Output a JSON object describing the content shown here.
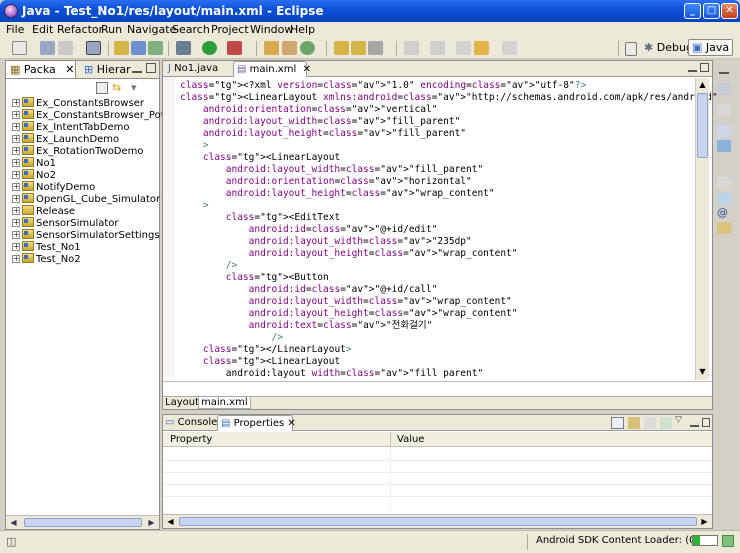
{
  "window": {
    "title": "Java - Test_No1/res/layout/main.xml - Eclipse"
  },
  "menu": [
    "File",
    "Edit",
    "Refactor",
    "Run",
    "Navigate",
    "Search",
    "Project",
    "Window",
    "Help"
  ],
  "perspectives": {
    "debug": "Debug",
    "java": "Java"
  },
  "left_pane": {
    "tabs": [
      "Packa",
      "Hierar"
    ],
    "projects": [
      "Ex_ConstantsBrowser",
      "Ex_ConstantsBrowser_Powe",
      "Ex_IntentTabDemo",
      "Ex_LaunchDemo",
      "Ex_RotationTwoDemo",
      "No1",
      "No2",
      "NotifyDemo",
      "OpenGL_Cube_Simulator",
      "Release",
      "SensorSimulator",
      "SensorSimulatorSettings",
      "Test_No1",
      "Test_No2"
    ]
  },
  "editor": {
    "tabs": [
      "No1.java",
      "main.xml"
    ],
    "bottom_tabs": [
      "Layout",
      "main.xml"
    ],
    "lines": [
      "<?xml version=\"1.0\" encoding=\"utf-8\"?>",
      "<LinearLayout xmlns:android=\"http://schemas.android.com/apk/res/android\"",
      "    android:orientation=\"vertical\"",
      "    android:layout_width=\"fill_parent\"",
      "    android:layout_height=\"fill_parent\"",
      "    >",
      "    <LinearLayout",
      "        android:layout_width=\"fill_parent\"",
      "        android:orientation=\"horizontal\"",
      "        android:layout_height=\"wrap_content\"",
      "    >",
      "        <EditText",
      "            android:id=\"@+id/edit\"",
      "            android:layout_width=\"235dp\"",
      "            android:layout_height=\"wrap_content\"",
      "        />",
      "        <Button",
      "            android:id=\"@+id/call\"",
      "            android:layout_width=\"wrap_content\"",
      "            android:layout_height=\"wrap_content\"",
      "            android:text=\"전화걸기\"",
      "                />",
      "    </LinearLayout>",
      "    <LinearLayout",
      "        android:layout width=\"fill parent\""
    ]
  },
  "bottom_pane": {
    "tabs": [
      "Console",
      "Properties"
    ],
    "columns": [
      "Property",
      "Value"
    ]
  },
  "status": {
    "loader": "Android SDK Content Loader: (0%)"
  }
}
